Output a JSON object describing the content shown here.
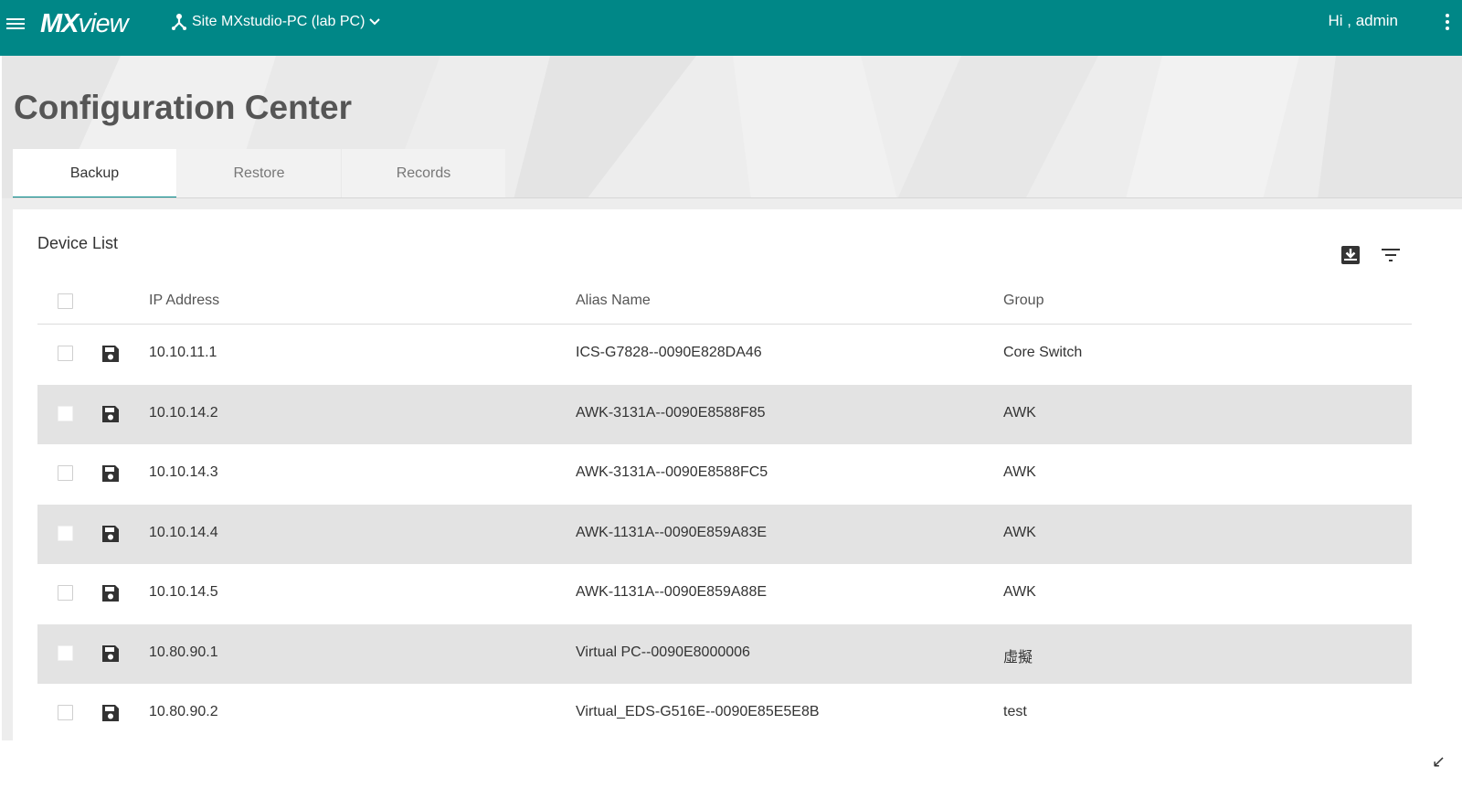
{
  "header": {
    "logo": {
      "bold": "MX",
      "light": "view"
    },
    "site_label": "Site MXstudio-PC (lab PC)",
    "greeting": "Hi , admin"
  },
  "page": {
    "title": "Configuration Center"
  },
  "tabs": [
    {
      "label": "Backup",
      "active": true
    },
    {
      "label": "Restore",
      "active": false
    },
    {
      "label": "Records",
      "active": false
    }
  ],
  "device_list": {
    "title": "Device List",
    "columns": {
      "ip": "IP Address",
      "alias": "Alias Name",
      "group": "Group"
    },
    "rows": [
      {
        "ip": "10.10.11.1",
        "alias": "ICS-G7828--0090E828DA46",
        "group": "Core Switch"
      },
      {
        "ip": "10.10.14.2",
        "alias": "AWK-3131A--0090E8588F85",
        "group": "AWK"
      },
      {
        "ip": "10.10.14.3",
        "alias": "AWK-3131A--0090E8588FC5",
        "group": "AWK"
      },
      {
        "ip": "10.10.14.4",
        "alias": "AWK-1131A--0090E859A83E",
        "group": "AWK"
      },
      {
        "ip": "10.10.14.5",
        "alias": "AWK-1131A--0090E859A88E",
        "group": "AWK"
      },
      {
        "ip": "10.80.90.1",
        "alias": "Virtual PC--0090E8000006",
        "group": "虛擬"
      },
      {
        "ip": "10.80.90.2",
        "alias": "Virtual_EDS-G516E--0090E85E5E8B",
        "group": "test"
      }
    ]
  },
  "colors": {
    "primary": "#008787",
    "row_alt": "#e3e3e3"
  },
  "icons": [
    "menu-icon",
    "site-topology-icon",
    "chevron-down-icon",
    "more-vert-icon",
    "export-icon",
    "filter-icon",
    "save-icon",
    "resize-corner-icon"
  ]
}
